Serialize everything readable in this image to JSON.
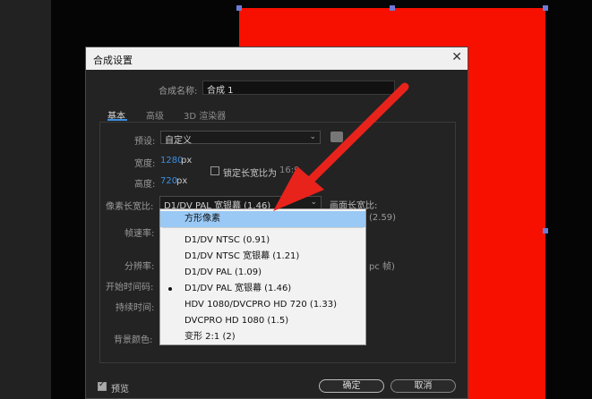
{
  "dialog": {
    "title": "合成设置",
    "name_label": "合成名称:",
    "name_value": "合成 1",
    "tabs": [
      "基本",
      "高级",
      "3D 渲染器"
    ],
    "preset_label": "预设:",
    "preset_value": "自定义",
    "width_label": "宽度:",
    "width_value": "1280",
    "height_label": "高度:",
    "height_value": "720",
    "unit_px": "px",
    "lock_ratio_label": "锁定长宽比为",
    "lock_ratio_value": "16:9",
    "pixel_aspect_label": "像素长宽比:",
    "pixel_aspect_value": "D1/DV PAL 宽银幕 (1.46)",
    "frame_aspect_label": "画面长宽比:",
    "frame_aspect_value": "(2.59)",
    "frame_rate_label": "帧速率:",
    "resolution_label": "分辨率:",
    "resolution_suffix": "pc 帧)",
    "start_timecode_label": "开始时间码:",
    "duration_label": "持续时间:",
    "bg_color_label": "背景颜色:",
    "preview_label": "预览",
    "ok_label": "确定",
    "cancel_label": "取消"
  },
  "menu": {
    "items": [
      {
        "label": "方形像素",
        "highlighted": true,
        "selected": false
      },
      {
        "label": "D1/DV NTSC (0.91)",
        "highlighted": false,
        "selected": false
      },
      {
        "label": "D1/DV NTSC 宽银幕 (1.21)",
        "highlighted": false,
        "selected": false
      },
      {
        "label": "D1/DV PAL (1.09)",
        "highlighted": false,
        "selected": false
      },
      {
        "label": "D1/DV PAL 宽银幕 (1.46)",
        "highlighted": false,
        "selected": true
      },
      {
        "label": "HDV 1080/DVCPRO HD 720 (1.33)",
        "highlighted": false,
        "selected": false
      },
      {
        "label": "DVCPRO HD 1080 (1.5)",
        "highlighted": false,
        "selected": false
      },
      {
        "label": "变形 2:1 (2)",
        "highlighted": false,
        "selected": false
      }
    ]
  },
  "colors": {
    "layer": "#f70f00",
    "arrow": "#e8231c",
    "accent": "#3d8ee0",
    "highlight": "#99c9f4"
  }
}
